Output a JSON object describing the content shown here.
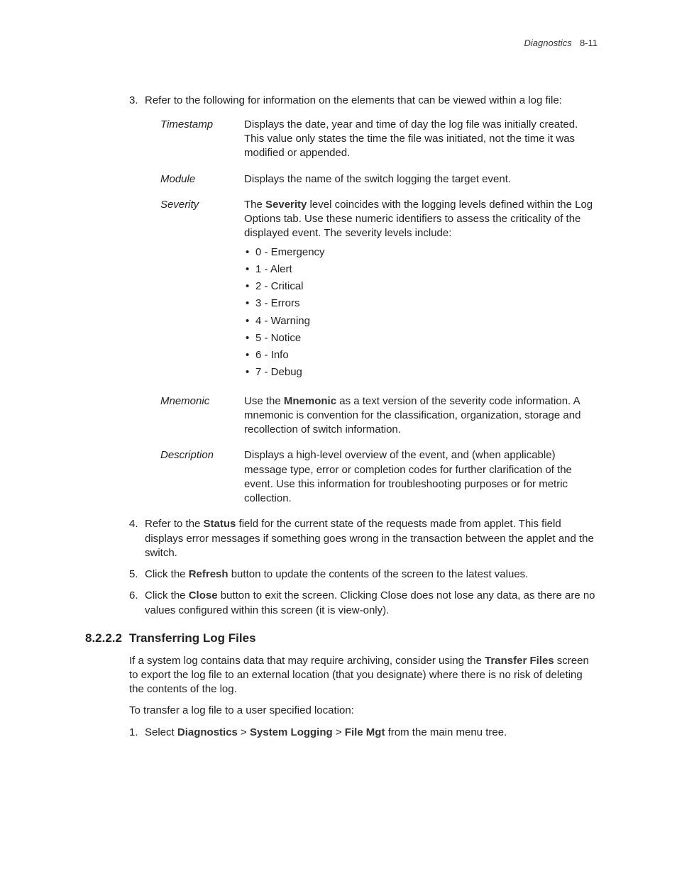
{
  "header": {
    "title": "Diagnostics",
    "page": "8-11"
  },
  "step3": {
    "num": "3.",
    "text": "Refer to the following for information on the elements that can be viewed within a log file:"
  },
  "defs": [
    {
      "term": "Timestamp",
      "body": "Displays the date, year and time of day the log file was initially created. This value only states the time the file was initiated, not the time it was modified or appended."
    },
    {
      "term": "Module",
      "body": "Displays the name of the switch logging the target event."
    },
    {
      "term": "Severity",
      "intro_pre": "The ",
      "intro_bold": "Severity",
      "intro_post": " level coincides with the logging levels defined within the Log Options tab. Use these numeric identifiers to assess the criticality of the displayed event. The severity levels include:",
      "bullets": [
        "0 - Emergency",
        "1 - Alert",
        "2 - Critical",
        "3 - Errors",
        "4 - Warning",
        "5 - Notice",
        "6 - Info",
        "7 - Debug"
      ]
    },
    {
      "term": "Mnemonic",
      "intro_pre": "Use the ",
      "intro_bold": "Mnemonic",
      "intro_post": " as a text version of the severity code information. A mnemonic is convention for the classification, organization, storage and recollection of switch information."
    },
    {
      "term": "Description",
      "body": "Displays a high-level overview of the event, and (when applicable) message type, error or completion codes for further clarification of the event. Use this information for troubleshooting purposes or for metric collection."
    }
  ],
  "step4": {
    "num": "4.",
    "pre": "Refer to the ",
    "bold": "Status",
    "post": " field for the current state of the requests made from applet. This field displays error messages if something goes wrong in the transaction between the applet and the switch."
  },
  "step5": {
    "num": "5.",
    "pre": "Click the ",
    "bold": "Refresh",
    "post": " button to update the contents of the screen to the latest values."
  },
  "step6": {
    "num": "6.",
    "pre": "Click the ",
    "bold": "Close",
    "post": " button to exit the screen. Clicking Close does not lose any data, as there are no values configured within this screen (it is view-only)."
  },
  "section": {
    "num": "8.2.2.2",
    "title": "Transferring Log Files",
    "p1_pre": "If a system log contains data that may require archiving, consider using the ",
    "p1_bold": "Transfer Files",
    "p1_post": " screen to export the log file to an external location (that you designate) where there is no risk of deleting the contents of the log.",
    "p2": "To transfer a log file to a user specified location:",
    "s1_num": "1.",
    "s1_pre": "Select ",
    "s1_b1": "Diagnostics",
    "s1_gt1": " > ",
    "s1_b2": "System Logging",
    "s1_gt2": " > ",
    "s1_b3": "File Mgt",
    "s1_post": " from the main menu tree."
  }
}
